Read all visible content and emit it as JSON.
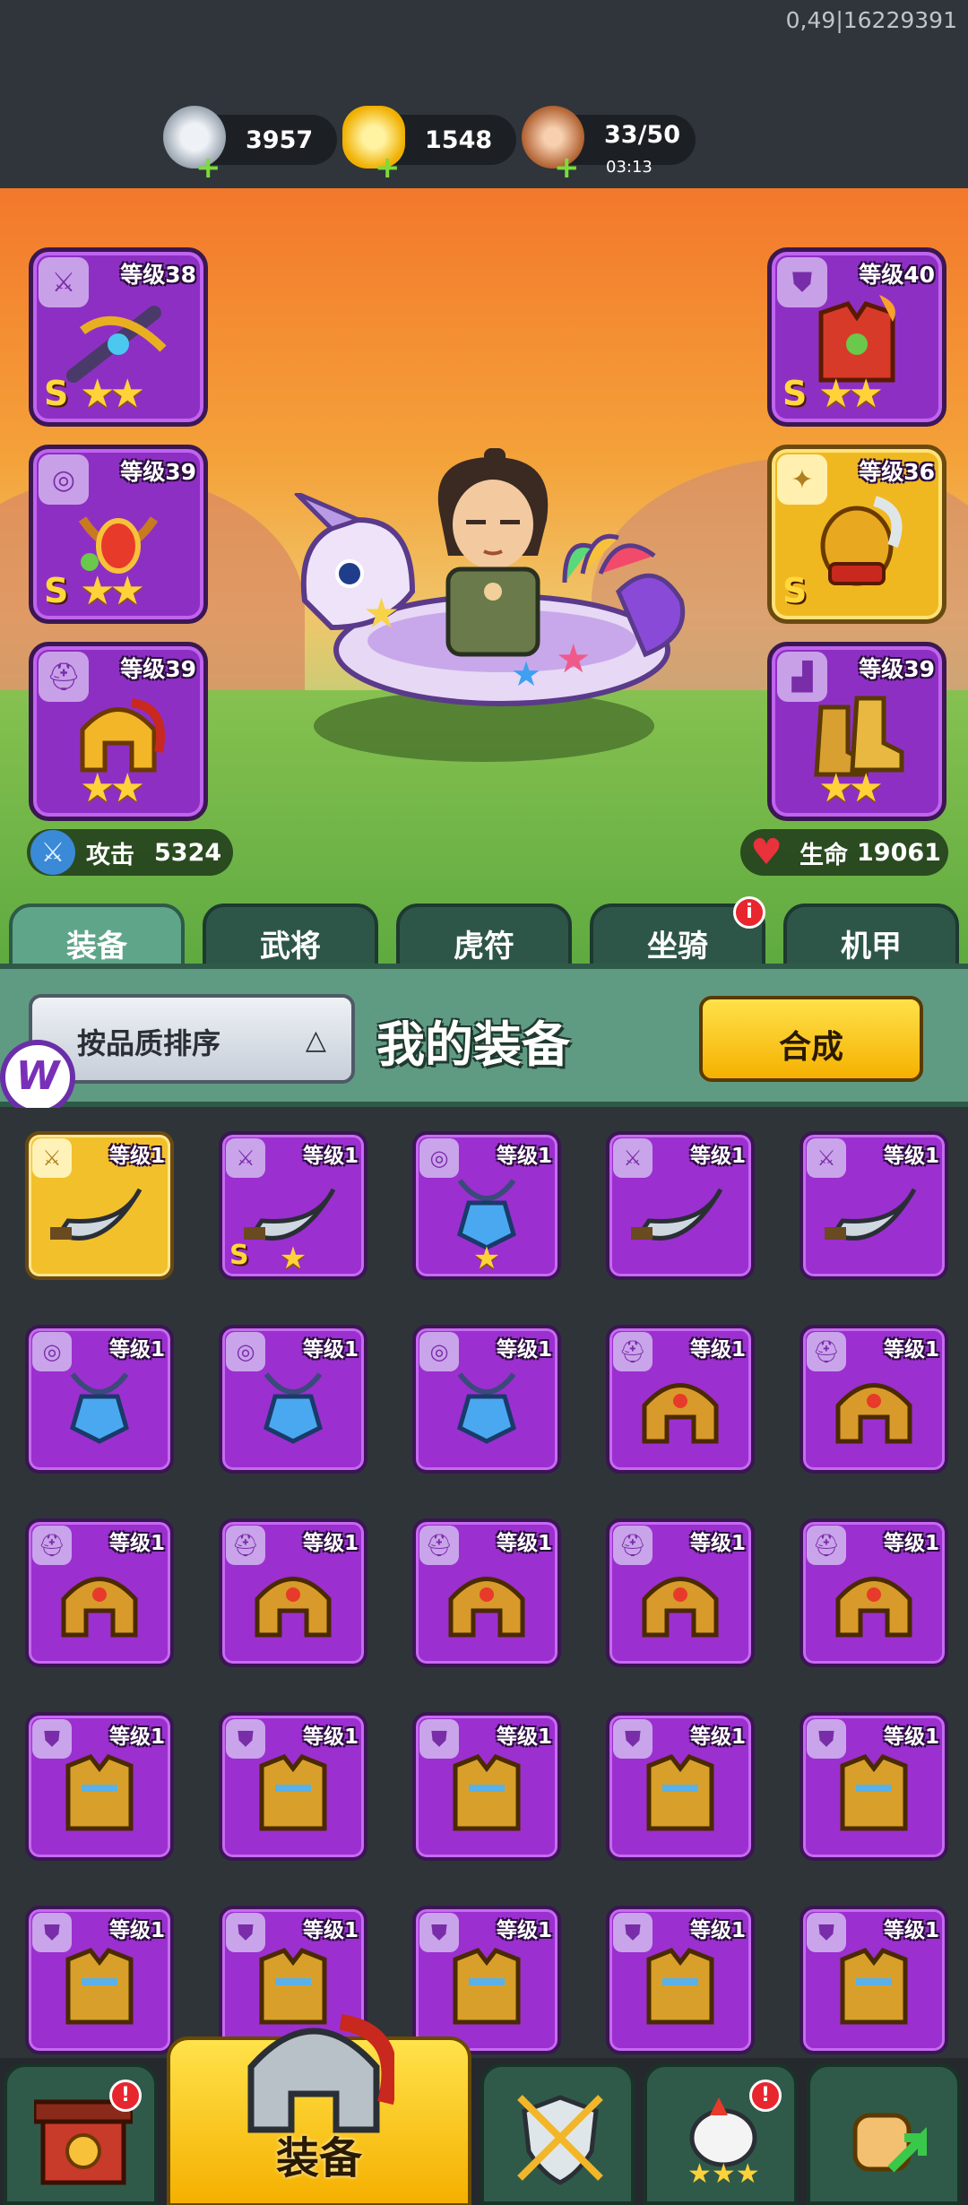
{
  "debug_text": "0,49|16229391",
  "resources": [
    {
      "name": "silver-coin",
      "value": "3957",
      "sub": ""
    },
    {
      "name": "gold-ingot",
      "value": "1548",
      "sub": ""
    },
    {
      "name": "meat-stamina",
      "value": "33/50",
      "sub": "03:13"
    }
  ],
  "equip_left": [
    {
      "level": "等级38",
      "rank": "S",
      "stars": "★★",
      "slot": "weapon"
    },
    {
      "level": "等级39",
      "rank": "S",
      "stars": "★★",
      "slot": "medal"
    },
    {
      "level": "等级39",
      "rank": "",
      "stars": "★★",
      "slot": "helmet"
    }
  ],
  "equip_right": [
    {
      "level": "等级40",
      "rank": "S",
      "stars": "★★",
      "slot": "armor"
    },
    {
      "level": "等级36",
      "rank": "S",
      "stars": "",
      "slot": "talisman"
    },
    {
      "level": "等级39",
      "rank": "",
      "stars": "★★",
      "slot": "boots"
    }
  ],
  "stats": {
    "attack_label": "攻击",
    "attack_value": "5324",
    "hp_label": "生命",
    "hp_value": "19061"
  },
  "tabs": [
    "装备",
    "武将",
    "虎符",
    "坐骑",
    "机甲"
  ],
  "tab_badge": "i",
  "panel": {
    "sort_label": "按品质排序",
    "sort_arrow": "△",
    "title": "我的装备",
    "combine_label": "合成"
  },
  "items_level": "等级1",
  "items": [
    {
      "slot": "weapon",
      "gold": true,
      "rank": "",
      "stars": ""
    },
    {
      "slot": "weapon",
      "gold": false,
      "rank": "S",
      "stars": "★"
    },
    {
      "slot": "medal",
      "gold": false,
      "rank": "",
      "stars": "★"
    },
    {
      "slot": "weapon",
      "gold": false,
      "rank": "",
      "stars": ""
    },
    {
      "slot": "weapon",
      "gold": false,
      "rank": "",
      "stars": ""
    },
    {
      "slot": "medal",
      "gold": false,
      "rank": "",
      "stars": ""
    },
    {
      "slot": "medal",
      "gold": false,
      "rank": "",
      "stars": ""
    },
    {
      "slot": "medal",
      "gold": false,
      "rank": "",
      "stars": ""
    },
    {
      "slot": "helmet",
      "gold": false,
      "rank": "",
      "stars": ""
    },
    {
      "slot": "helmet",
      "gold": false,
      "rank": "",
      "stars": ""
    },
    {
      "slot": "helmet",
      "gold": false,
      "rank": "",
      "stars": ""
    },
    {
      "slot": "helmet",
      "gold": false,
      "rank": "",
      "stars": ""
    },
    {
      "slot": "helmet",
      "gold": false,
      "rank": "",
      "stars": ""
    },
    {
      "slot": "helmet",
      "gold": false,
      "rank": "",
      "stars": ""
    },
    {
      "slot": "helmet",
      "gold": false,
      "rank": "",
      "stars": ""
    },
    {
      "slot": "armor",
      "gold": false,
      "rank": "",
      "stars": ""
    },
    {
      "slot": "armor",
      "gold": false,
      "rank": "",
      "stars": ""
    },
    {
      "slot": "armor",
      "gold": false,
      "rank": "",
      "stars": ""
    },
    {
      "slot": "armor",
      "gold": false,
      "rank": "",
      "stars": ""
    },
    {
      "slot": "armor",
      "gold": false,
      "rank": "",
      "stars": ""
    },
    {
      "slot": "armor",
      "gold": false,
      "rank": "",
      "stars": ""
    },
    {
      "slot": "armor",
      "gold": false,
      "rank": "",
      "stars": ""
    },
    {
      "slot": "armor",
      "gold": false,
      "rank": "",
      "stars": ""
    },
    {
      "slot": "armor",
      "gold": false,
      "rank": "",
      "stars": ""
    },
    {
      "slot": "armor",
      "gold": false,
      "rank": "",
      "stars": ""
    }
  ],
  "bottom_nav": {
    "active_label": "装备",
    "buttons": [
      "shop-gate-icon",
      "equipment-helmet-icon",
      "battle-shield-icon",
      "chicken-stars-icon",
      "fist-upgrade-icon"
    ],
    "badge": "!"
  },
  "colors": {
    "epic": "#9c2fd0",
    "legendary": "#f2c02a",
    "tab_active": "#5fa58a",
    "accent_yellow": "#f5b100"
  }
}
